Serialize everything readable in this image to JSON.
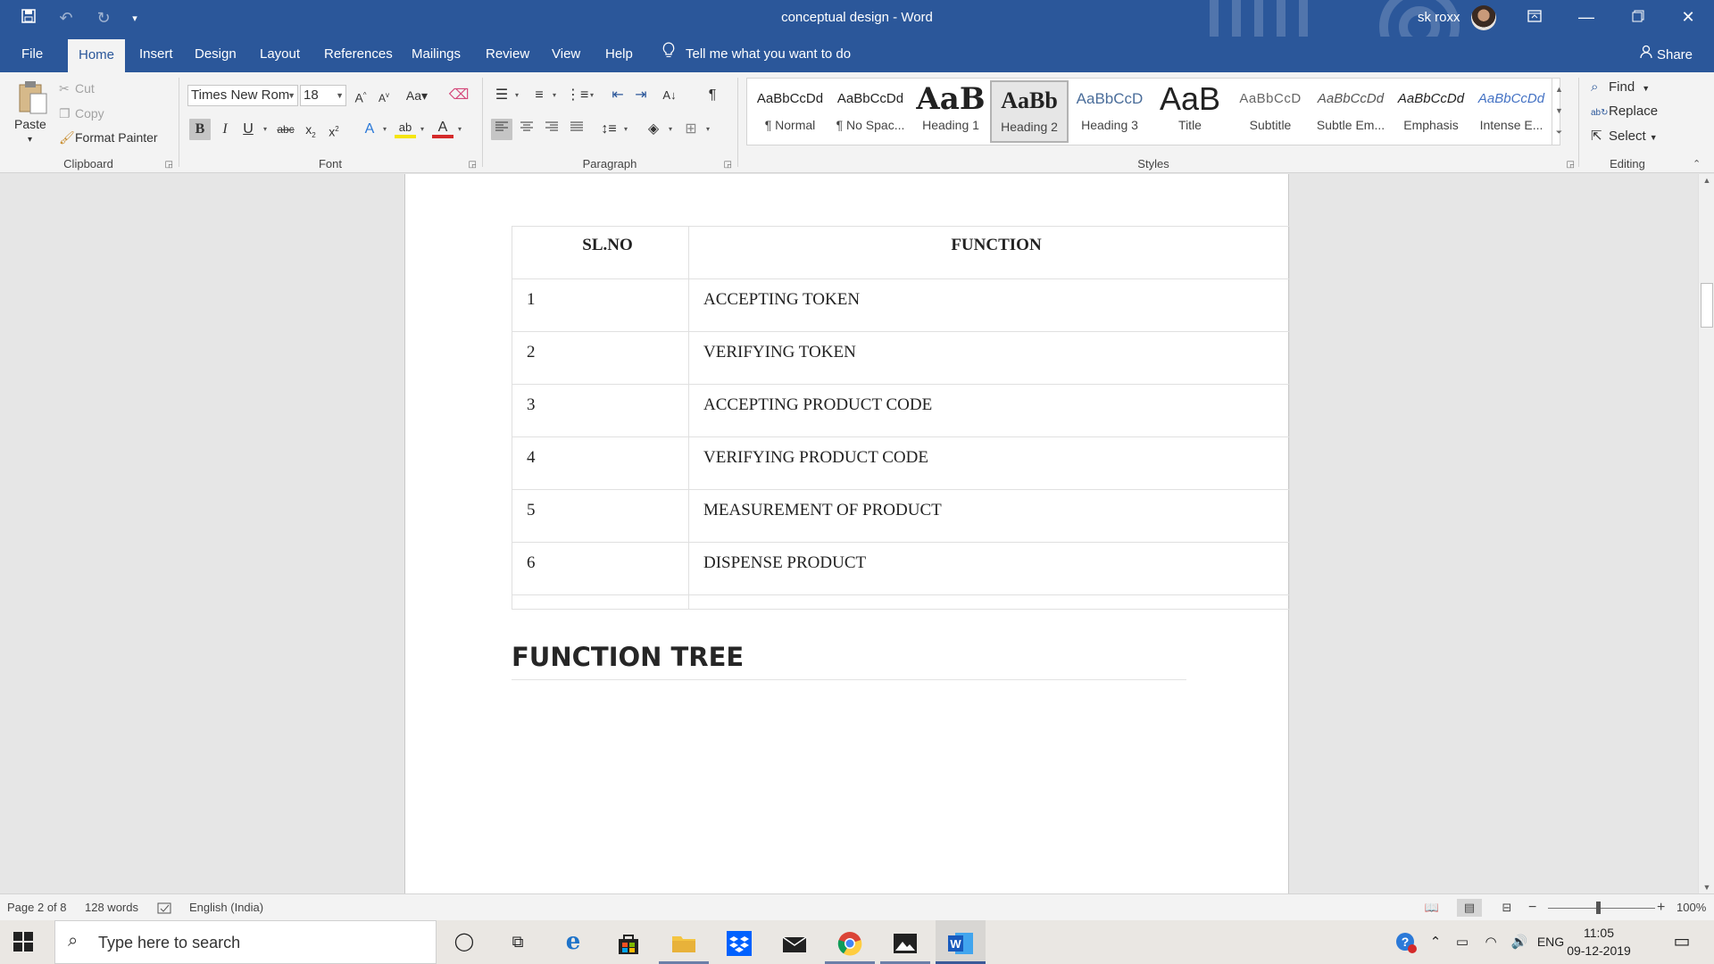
{
  "window": {
    "title": "conceptual design  -  Word",
    "user_name": "sk roxx",
    "qat": {
      "save_icon": "save-icon",
      "undo_icon": "undo-icon",
      "redo_icon": "redo-icon",
      "customize_icon": "customize-qat-icon"
    },
    "controls": {
      "restore_ribbon": "ribbon-display-icon",
      "minimize": "minimize-icon",
      "maximize": "maximize-icon",
      "close": "close-icon"
    }
  },
  "tabs": [
    "File",
    "Home",
    "Insert",
    "Design",
    "Layout",
    "References",
    "Mailings",
    "Review",
    "View",
    "Help"
  ],
  "active_tab": "Home",
  "tell_me": "Tell me what you want to do",
  "share": "Share",
  "clipboard": {
    "paste": "Paste",
    "cut": "Cut",
    "copy": "Copy",
    "format_painter": "Format Painter",
    "title": "Clipboard"
  },
  "font": {
    "name": "Times New Rom",
    "size": "18",
    "title": "Font",
    "bold": "B",
    "italic": "I",
    "underline": "U",
    "strike": "abc"
  },
  "paragraph": {
    "title": "Paragraph"
  },
  "styles": {
    "title": "Styles",
    "items": [
      {
        "preview": "AaBbCcDd",
        "name": "¶ Normal"
      },
      {
        "preview": "AaBbCcDd",
        "name": "¶ No Spac..."
      },
      {
        "preview": "AaB",
        "name": "Heading 1"
      },
      {
        "preview": "AaBb",
        "name": "Heading 2"
      },
      {
        "preview": "AaBbCcD",
        "name": "Heading 3"
      },
      {
        "preview": "AaB",
        "name": "Title"
      },
      {
        "preview": "AaBbCcD",
        "name": "Subtitle"
      },
      {
        "preview": "AaBbCcDd",
        "name": "Subtle Em..."
      },
      {
        "preview": "AaBbCcDd",
        "name": "Emphasis"
      },
      {
        "preview": "AaBbCcDd",
        "name": "Intense E..."
      }
    ],
    "selected": "Heading 2"
  },
  "editing": {
    "find": "Find",
    "replace": "Replace",
    "select": "Select",
    "title": "Editing"
  },
  "document": {
    "table": {
      "headers": [
        "SL.NO",
        "FUNCTION"
      ],
      "rows": [
        [
          "1",
          "ACCEPTING TOKEN"
        ],
        [
          "2",
          "VERIFYING TOKEN"
        ],
        [
          "3",
          "ACCEPTING PRODUCT CODE"
        ],
        [
          "4",
          "VERIFYING PRODUCT CODE"
        ],
        [
          "5",
          "MEASUREMENT OF PRODUCT"
        ],
        [
          "6",
          "DISPENSE PRODUCT"
        ]
      ]
    },
    "heading": "FUNCTION TREE"
  },
  "status": {
    "page": "Page 2 of 8",
    "words": "128 words",
    "language": "English (India)",
    "zoom": "100%"
  },
  "taskbar": {
    "search_placeholder": "Type here to search",
    "apps": [
      "cortana-icon",
      "task-view-icon",
      "edge-icon",
      "store-icon",
      "file-explorer-icon",
      "dropbox-icon",
      "mail-icon",
      "chrome-icon",
      "photos-icon",
      "word-icon"
    ],
    "tray": {
      "language": "ENG",
      "time": "11:05",
      "date": "09-12-2019"
    }
  }
}
